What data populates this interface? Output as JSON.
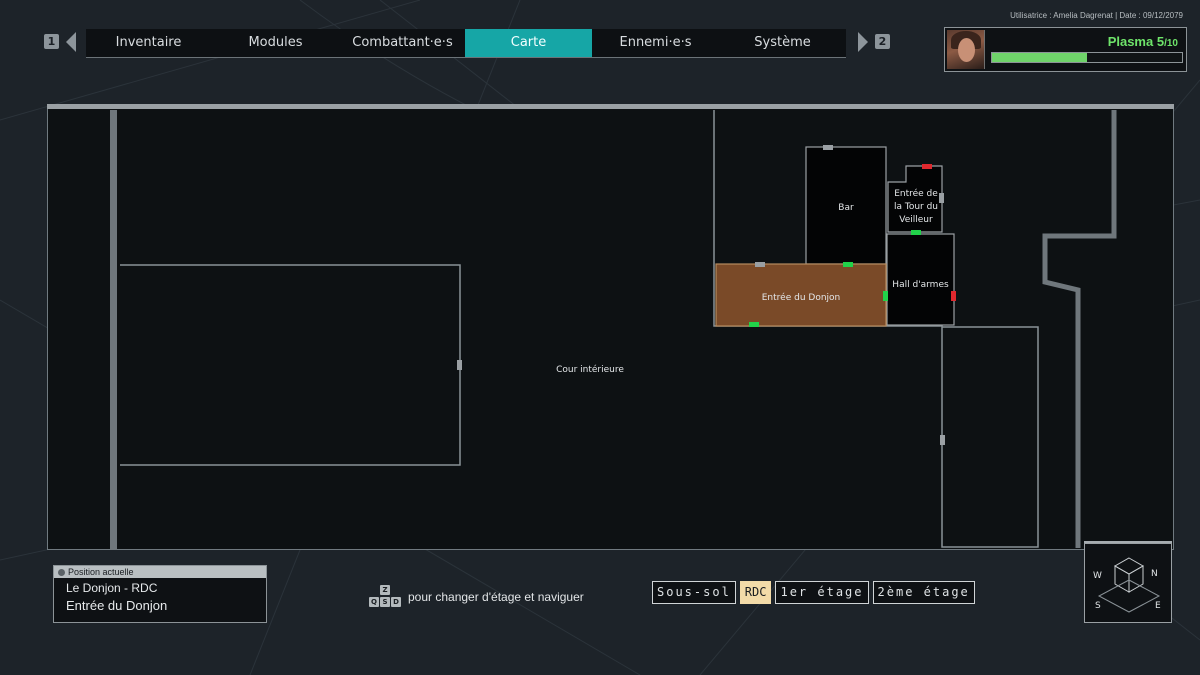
{
  "header": {
    "user_line": "Utilisatrice : Amelia Dagrenat | Date : 09/12/2079",
    "nav_left_key": "1",
    "nav_right_key": "2"
  },
  "tabs": [
    {
      "label": "Inventaire",
      "active": false
    },
    {
      "label": "Modules",
      "active": false
    },
    {
      "label": "Combattant·e·s",
      "active": false
    },
    {
      "label": "Carte",
      "active": true
    },
    {
      "label": "Ennemi·e·s",
      "active": false
    },
    {
      "label": "Système",
      "active": false
    }
  ],
  "player": {
    "resource_name": "Plasma",
    "current": "5",
    "max": "10",
    "fill_fraction": 0.5,
    "bar_color": "#6fd46a"
  },
  "map": {
    "rooms": {
      "courtyard": "Cour intérieure",
      "dungeon_entrance": "Entrée du Donjon",
      "bar": "Bar",
      "watcher_tower": "Entrée de la Tour du Veilleur",
      "armory": "Hall d'armes"
    },
    "highlight_color": "#7a4a28",
    "open_door_color": "#21d24a",
    "locked_door_color": "#e0282e"
  },
  "position_panel": {
    "header": "Position actuelle",
    "location": "Le Donjon - RDC",
    "room": "Entrée du Donjon"
  },
  "controls": {
    "keys": [
      "Z",
      "Q",
      "S",
      "D"
    ],
    "hint": "pour changer d'étage et naviguer"
  },
  "floors": [
    {
      "label": "Sous-sol",
      "selected": false
    },
    {
      "label": "RDC",
      "selected": true
    },
    {
      "label": "1er étage",
      "selected": false
    },
    {
      "label": "2ème étage",
      "selected": false
    }
  ],
  "compass": {
    "directions": [
      "N",
      "E",
      "S",
      "W"
    ]
  }
}
